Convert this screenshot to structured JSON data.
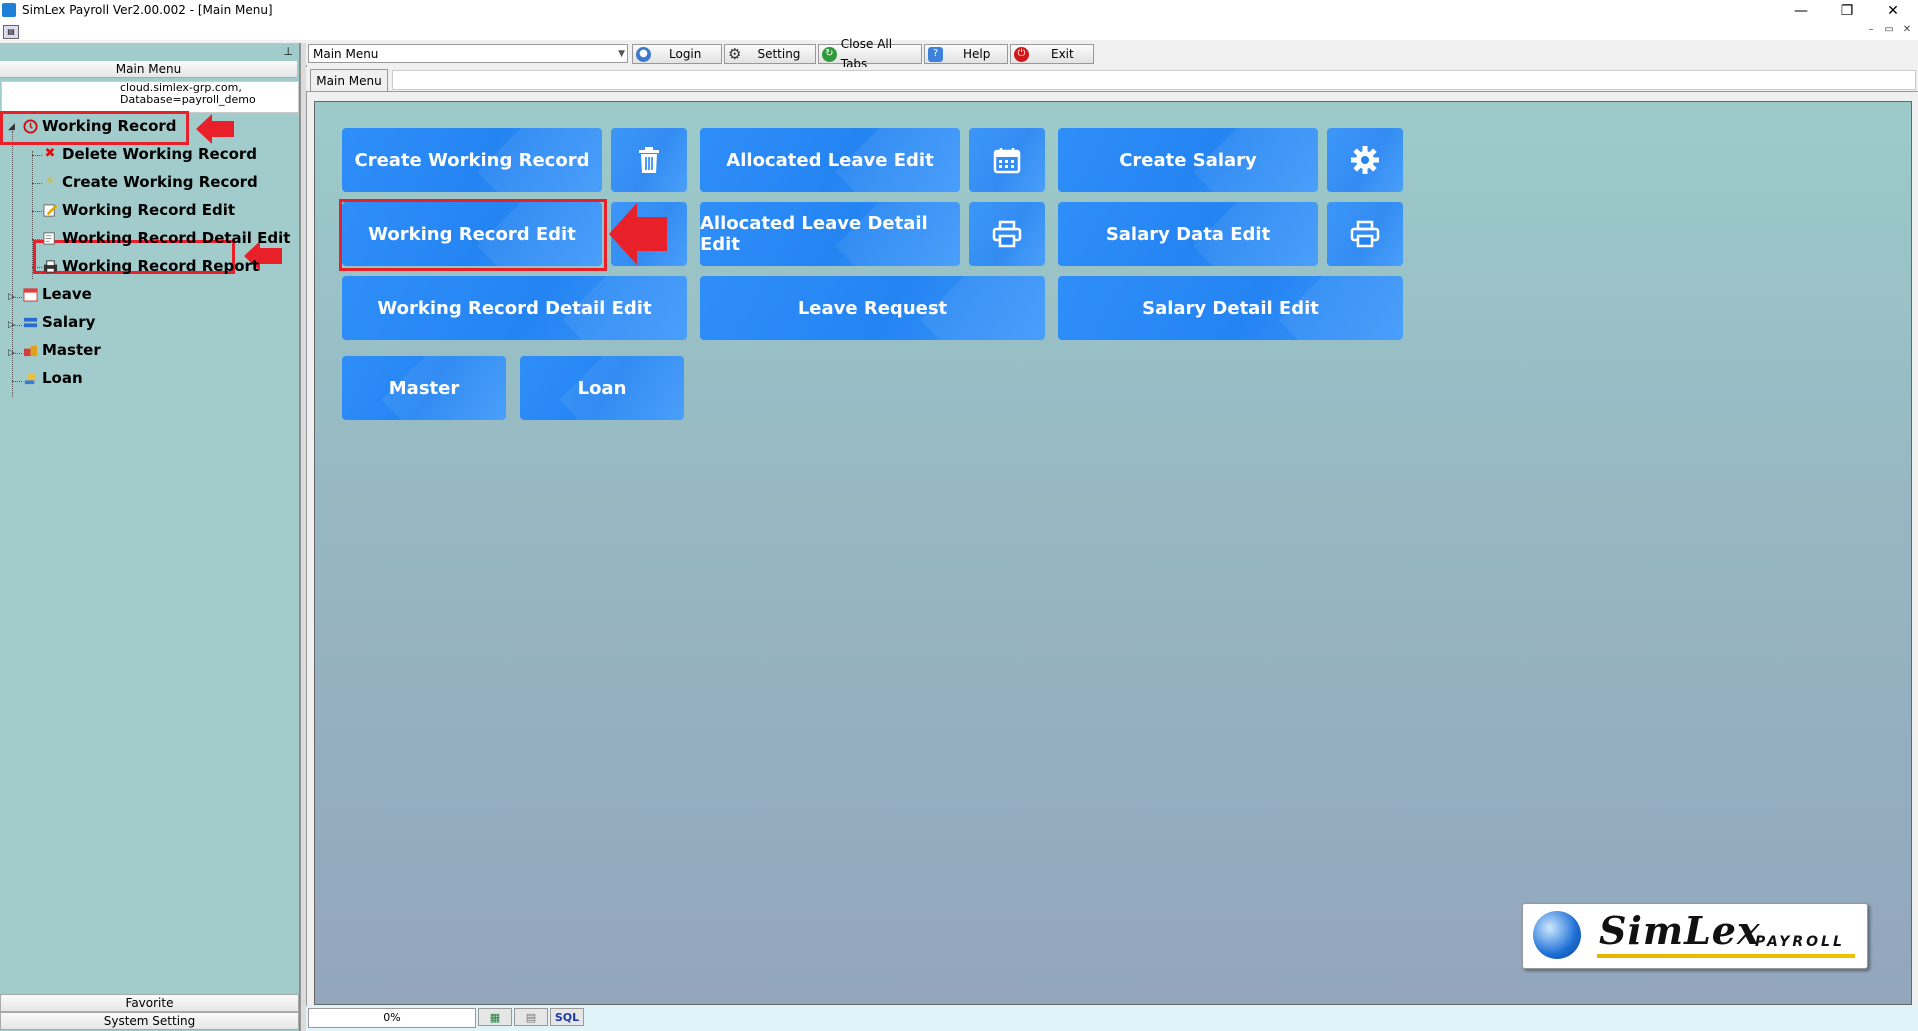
{
  "window": {
    "title": "SimLex Payroll Ver2.00.002 - [Main Menu]",
    "minimize": "—",
    "maximize": "❐",
    "close": "✕"
  },
  "left_panel": {
    "header": "Main Menu",
    "connection_line1": "cloud.simlex-grp.com,",
    "connection_line2": "Database=payroll_demo",
    "tree": {
      "working_record": "Working Record",
      "delete_working_record": "Delete Working Record",
      "create_working_record": "Create Working Record",
      "working_record_edit": "Working Record Edit",
      "working_record_detail_edit": "Working Record Detail Edit",
      "working_record_report": "Working Record Report",
      "leave": "Leave",
      "salary": "Salary",
      "master": "Master",
      "loan": "Loan"
    },
    "favorite": "Favorite",
    "system_setting": "System Setting"
  },
  "toolbar": {
    "combo_value": "Main Menu",
    "login": "Login",
    "setting": "Setting",
    "close_all_tabs": "Close All Tabs",
    "help": "Help",
    "exit": "Exit"
  },
  "tabs": {
    "main_menu": "Main Menu"
  },
  "tiles": {
    "create_working_record": "Create Working Record",
    "allocated_leave_edit": "Allocated Leave Edit",
    "create_salary": "Create Salary",
    "working_record_edit": "Working Record Edit",
    "allocated_leave_detail_edit": "Allocated Leave Detail Edit",
    "salary_data_edit": "Salary Data Edit",
    "working_record_detail_edit": "Working Record Detail Edit",
    "leave_request": "Leave Request",
    "salary_detail_edit": "Salary Detail Edit",
    "master": "Master",
    "loan": "Loan"
  },
  "logo": {
    "brand": "SimLex",
    "sub": "PAYROLL"
  },
  "status": {
    "progress": "0%",
    "sql": "SQL"
  },
  "colors": {
    "tile_blue": "#2484f2",
    "highlight_red": "#e8202a",
    "panel_teal": "#a2cccb"
  }
}
